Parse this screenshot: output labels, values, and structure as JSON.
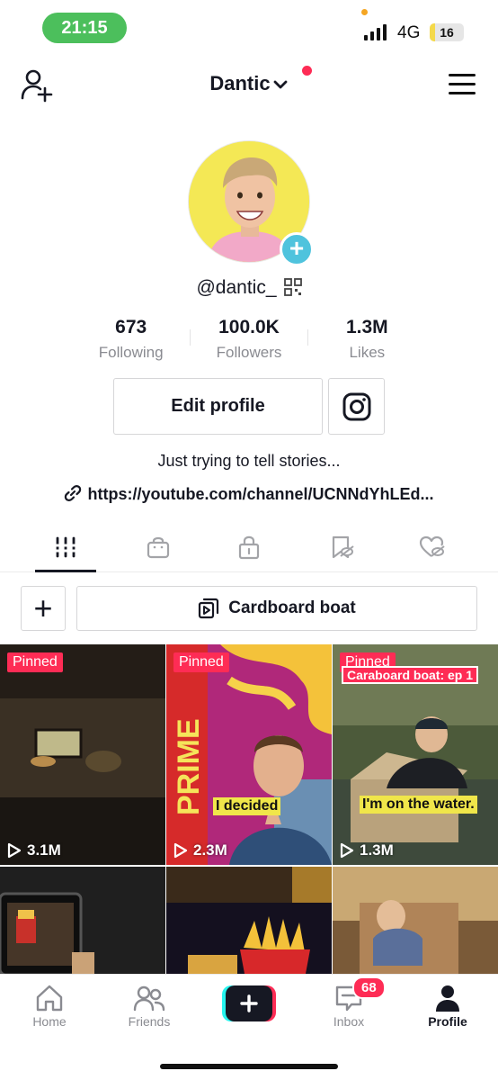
{
  "status_bar": {
    "time": "21:15",
    "network": "4G",
    "battery": "16",
    "battery_level_percent": 16
  },
  "header": {
    "username": "Dantic"
  },
  "profile": {
    "handle": "@dantic_",
    "stats": [
      {
        "value": "673",
        "label": "Following"
      },
      {
        "value": "100.0K",
        "label": "Followers"
      },
      {
        "value": "1.3M",
        "label": "Likes"
      }
    ],
    "edit_profile_label": "Edit profile",
    "bio": "Just trying to tell stories...",
    "link": "https://youtube.com/channel/UCNNdYhLEd..."
  },
  "tabs": [
    {
      "icon": "videos-grid-icon"
    },
    {
      "icon": "shop-bag-icon"
    },
    {
      "icon": "lock-icon"
    },
    {
      "icon": "hidden-bookmark-icon"
    },
    {
      "icon": "hidden-heart-icon"
    }
  ],
  "playlist": {
    "name": "Cardboard boat"
  },
  "videos": [
    {
      "pinned": "Pinned",
      "views": "3.1M",
      "caption": ""
    },
    {
      "pinned": "Pinned",
      "views": "2.3M",
      "caption": "I decided"
    },
    {
      "pinned": "Pinned",
      "views": "1.3M",
      "caption": "I'm on the water.",
      "top_text": "Caraboard boat: ep 1"
    },
    {
      "pinned": "",
      "views": "",
      "caption": ""
    },
    {
      "pinned": "",
      "views": "",
      "caption": ""
    },
    {
      "pinned": "",
      "views": "",
      "caption": ""
    }
  ],
  "nav": {
    "home": "Home",
    "friends": "Friends",
    "inbox": "Inbox",
    "inbox_badge": "68",
    "profile": "Profile"
  },
  "colors": {
    "accent": "#fe2c55",
    "status_pill": "#4cbf5c",
    "avatar_bg": "#f4e855",
    "plus_badge": "#4fc3dd"
  }
}
